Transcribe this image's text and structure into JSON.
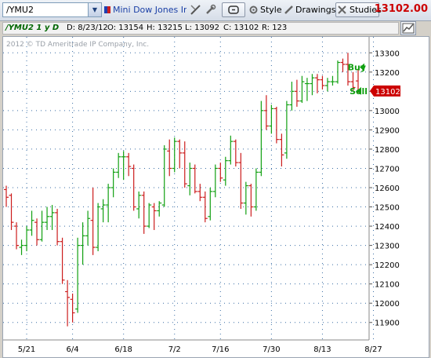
{
  "toolbar": {
    "symbol": "/YMU2",
    "description": "Mini Dow Jones Ind...",
    "style_label": "Style",
    "drawings_label": "Drawings",
    "studies_label": "Studies",
    "last_price": "13102.00",
    "last_price_color": "#cc0000"
  },
  "infobar": {
    "symbol_period": "/YMU2 1 y D",
    "date": "D: 8/23/12",
    "open": "O: 13154",
    "high": "H: 13215",
    "low": "L: 13092",
    "close": "C: 13102",
    "range": "R: 123"
  },
  "watermark": "2012 © TD Ameritrade IP Company, Inc.",
  "markers": {
    "buy_label": "Buy",
    "sell_label": "Sell",
    "price_tag": "13102",
    "buy_color": "#11a011",
    "tag_color": "#cc0000"
  },
  "chart_data": {
    "type": "ohlc",
    "up_color": "#11a011",
    "down_color": "#cc1c1c",
    "ylim": [
      11850,
      13350
    ],
    "grid": true,
    "y_ticks": [
      11900,
      12000,
      12100,
      12200,
      12300,
      12400,
      12500,
      12600,
      12700,
      12800,
      12900,
      13000,
      13100,
      13200,
      13300
    ],
    "x_ticks": [
      {
        "label": "5/21",
        "index": 4
      },
      {
        "label": "6/4",
        "index": 13
      },
      {
        "label": "6/18",
        "index": 23
      },
      {
        "label": "7/2",
        "index": 33
      },
      {
        "label": "7/16",
        "index": 42
      },
      {
        "label": "7/30",
        "index": 52
      },
      {
        "label": "8/13",
        "index": 62
      },
      {
        "label": "8/27",
        "index": 72
      }
    ],
    "bars": [
      {
        "o": 12590,
        "h": 12610,
        "l": 12500,
        "c": 12550
      },
      {
        "o": 12560,
        "h": 12570,
        "l": 12380,
        "c": 12420
      },
      {
        "o": 12400,
        "h": 12420,
        "l": 12280,
        "c": 12300
      },
      {
        "o": 12290,
        "h": 12330,
        "l": 12250,
        "c": 12300
      },
      {
        "o": 12300,
        "h": 12400,
        "l": 12270,
        "c": 12380
      },
      {
        "o": 12380,
        "h": 12480,
        "l": 12350,
        "c": 12430
      },
      {
        "o": 12420,
        "h": 12440,
        "l": 12300,
        "c": 12330
      },
      {
        "o": 12330,
        "h": 12480,
        "l": 12320,
        "c": 12420
      },
      {
        "o": 12420,
        "h": 12500,
        "l": 12380,
        "c": 12450
      },
      {
        "o": 12450,
        "h": 12510,
        "l": 12380,
        "c": 12470
      },
      {
        "o": 12470,
        "h": 12490,
        "l": 12300,
        "c": 12320
      },
      {
        "o": 12320,
        "h": 12340,
        "l": 12100,
        "c": 12120
      },
      {
        "o": 12060,
        "h": 12120,
        "l": 11880,
        "c": 12030
      },
      {
        "o": 12020,
        "h": 12050,
        "l": 11900,
        "c": 11950
      },
      {
        "o": 11970,
        "h": 12340,
        "l": 11950,
        "c": 12300
      },
      {
        "o": 12300,
        "h": 12420,
        "l": 12200,
        "c": 12350
      },
      {
        "o": 12350,
        "h": 12480,
        "l": 12300,
        "c": 12440
      },
      {
        "o": 12430,
        "h": 12600,
        "l": 12250,
        "c": 12290
      },
      {
        "o": 12290,
        "h": 12520,
        "l": 12270,
        "c": 12500
      },
      {
        "o": 12490,
        "h": 12540,
        "l": 12420,
        "c": 12510
      },
      {
        "o": 12510,
        "h": 12620,
        "l": 12420,
        "c": 12600
      },
      {
        "o": 12600,
        "h": 12700,
        "l": 12550,
        "c": 12680
      },
      {
        "o": 12680,
        "h": 12780,
        "l": 12650,
        "c": 12760
      },
      {
        "o": 12760,
        "h": 12790,
        "l": 12640,
        "c": 12760
      },
      {
        "o": 12760,
        "h": 12780,
        "l": 12660,
        "c": 12710
      },
      {
        "o": 12700,
        "h": 12720,
        "l": 12480,
        "c": 12500
      },
      {
        "o": 12490,
        "h": 12580,
        "l": 12440,
        "c": 12560
      },
      {
        "o": 12560,
        "h": 12580,
        "l": 12360,
        "c": 12400
      },
      {
        "o": 12400,
        "h": 12520,
        "l": 12390,
        "c": 12510
      },
      {
        "o": 12500,
        "h": 12520,
        "l": 12380,
        "c": 12480
      },
      {
        "o": 12480,
        "h": 12530,
        "l": 12450,
        "c": 12520
      },
      {
        "o": 12510,
        "h": 12820,
        "l": 12500,
        "c": 12800
      },
      {
        "o": 12790,
        "h": 12850,
        "l": 12660,
        "c": 12700
      },
      {
        "o": 12700,
        "h": 12860,
        "l": 12680,
        "c": 12840
      },
      {
        "o": 12840,
        "h": 12850,
        "l": 12700,
        "c": 12780
      },
      {
        "o": 12780,
        "h": 12840,
        "l": 12600,
        "c": 12620
      },
      {
        "o": 12610,
        "h": 12730,
        "l": 12560,
        "c": 12700
      },
      {
        "o": 12700,
        "h": 12720,
        "l": 12570,
        "c": 12580
      },
      {
        "o": 12580,
        "h": 12620,
        "l": 12530,
        "c": 12550
      },
      {
        "o": 12550,
        "h": 12580,
        "l": 12420,
        "c": 12440
      },
      {
        "o": 12450,
        "h": 12600,
        "l": 12430,
        "c": 12580
      },
      {
        "o": 12580,
        "h": 12720,
        "l": 12550,
        "c": 12700
      },
      {
        "o": 12700,
        "h": 12730,
        "l": 12630,
        "c": 12650
      },
      {
        "o": 12640,
        "h": 12760,
        "l": 12610,
        "c": 12740
      },
      {
        "o": 12740,
        "h": 12870,
        "l": 12720,
        "c": 12840
      },
      {
        "o": 12840,
        "h": 12850,
        "l": 12710,
        "c": 12730
      },
      {
        "o": 12730,
        "h": 12780,
        "l": 12490,
        "c": 12520
      },
      {
        "o": 12520,
        "h": 12630,
        "l": 12460,
        "c": 12610
      },
      {
        "o": 12610,
        "h": 12620,
        "l": 12450,
        "c": 12500
      },
      {
        "o": 12500,
        "h": 12700,
        "l": 12480,
        "c": 12680
      },
      {
        "o": 12680,
        "h": 13050,
        "l": 12660,
        "c": 13000
      },
      {
        "o": 13000,
        "h": 13080,
        "l": 12900,
        "c": 12920
      },
      {
        "o": 12920,
        "h": 13030,
        "l": 12880,
        "c": 13010
      },
      {
        "o": 13010,
        "h": 13020,
        "l": 12830,
        "c": 12850
      },
      {
        "o": 12850,
        "h": 12880,
        "l": 12710,
        "c": 12770
      },
      {
        "o": 12780,
        "h": 13050,
        "l": 12750,
        "c": 13030
      },
      {
        "o": 13030,
        "h": 13150,
        "l": 13000,
        "c": 13100
      },
      {
        "o": 13100,
        "h": 13160,
        "l": 13020,
        "c": 13050
      },
      {
        "o": 13050,
        "h": 13180,
        "l": 13040,
        "c": 13150
      },
      {
        "o": 13140,
        "h": 13170,
        "l": 13050,
        "c": 13140
      },
      {
        "o": 13140,
        "h": 13190,
        "l": 13080,
        "c": 13170
      },
      {
        "o": 13170,
        "h": 13190,
        "l": 13090,
        "c": 13160
      },
      {
        "o": 13160,
        "h": 13180,
        "l": 13110,
        "c": 13130
      },
      {
        "o": 13130,
        "h": 13170,
        "l": 13100,
        "c": 13150
      },
      {
        "o": 13150,
        "h": 13180,
        "l": 13130,
        "c": 13150
      },
      {
        "o": 13150,
        "h": 13260,
        "l": 13140,
        "c": 13250
      },
      {
        "o": 13250,
        "h": 13270,
        "l": 13200,
        "c": 13240
      },
      {
        "o": 13240,
        "h": 13300,
        "l": 13130,
        "c": 13150
      },
      {
        "o": 13150,
        "h": 13200,
        "l": 13100,
        "c": 13120
      },
      {
        "o": 13154,
        "h": 13215,
        "l": 13092,
        "c": 13102
      }
    ]
  }
}
